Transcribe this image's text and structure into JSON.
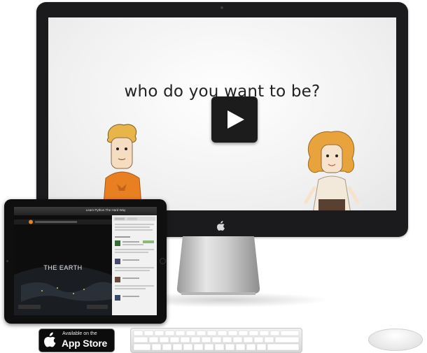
{
  "screen": {
    "headline": "who do you want to be?"
  },
  "ipad": {
    "app_title": "Learn Python The Hard Way",
    "tablet_subtitle": "THE EARTH"
  },
  "appstore": {
    "small_text": "Available on the",
    "big_text": "App Store"
  },
  "icons": {
    "play": "play-icon",
    "apple": "apple-logo-icon"
  },
  "colors": {
    "monitor_bezel": "#1b1b1d",
    "screen_bg": "#f2f2f2",
    "play_button": "#1c1c1c",
    "boy_shirt": "#e88021",
    "girl_hair": "#e8a33c"
  }
}
